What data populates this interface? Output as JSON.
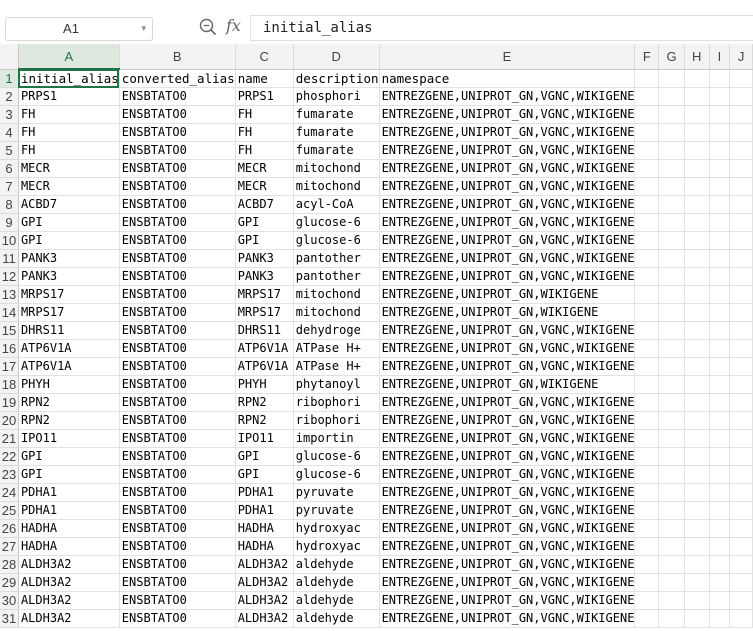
{
  "formula_bar": {
    "name_box": "A1",
    "formula": "initial_alias"
  },
  "columns": [
    "A",
    "B",
    "C",
    "D",
    "E",
    "F",
    "G",
    "H",
    "I",
    "J"
  ],
  "rows": [
    [
      "initial_alias",
      "converted_alias",
      "name",
      "description",
      "namespace"
    ],
    [
      "PRPS1",
      "ENSBTATO0",
      "PRPS1",
      "phosphori",
      "ENTREZGENE,UNIPROT_GN,VGNC,WIKIGENE"
    ],
    [
      "FH",
      "ENSBTATO0",
      "FH",
      "fumarate",
      "ENTREZGENE,UNIPROT_GN,VGNC,WIKIGENE"
    ],
    [
      "FH",
      "ENSBTATO0",
      "FH",
      "fumarate",
      "ENTREZGENE,UNIPROT_GN,VGNC,WIKIGENE"
    ],
    [
      "FH",
      "ENSBTATO0",
      "FH",
      "fumarate",
      "ENTREZGENE,UNIPROT_GN,VGNC,WIKIGENE"
    ],
    [
      "MECR",
      "ENSBTATO0",
      "MECR",
      "mitochond",
      "ENTREZGENE,UNIPROT_GN,VGNC,WIKIGENE"
    ],
    [
      "MECR",
      "ENSBTATO0",
      "MECR",
      "mitochond",
      "ENTREZGENE,UNIPROT_GN,VGNC,WIKIGENE"
    ],
    [
      "ACBD7",
      "ENSBTATO0",
      "ACBD7",
      "acyl-CoA",
      "ENTREZGENE,UNIPROT_GN,VGNC,WIKIGENE"
    ],
    [
      "GPI",
      "ENSBTATO0",
      "GPI",
      "glucose-6",
      "ENTREZGENE,UNIPROT_GN,VGNC,WIKIGENE"
    ],
    [
      "GPI",
      "ENSBTATO0",
      "GPI",
      "glucose-6",
      "ENTREZGENE,UNIPROT_GN,VGNC,WIKIGENE"
    ],
    [
      "PANK3",
      "ENSBTATO0",
      "PANK3",
      "pantother",
      "ENTREZGENE,UNIPROT_GN,VGNC,WIKIGENE"
    ],
    [
      "PANK3",
      "ENSBTATO0",
      "PANK3",
      "pantother",
      "ENTREZGENE,UNIPROT_GN,VGNC,WIKIGENE"
    ],
    [
      "MRPS17",
      "ENSBTATO0",
      "MRPS17",
      "mitochond",
      "ENTREZGENE,UNIPROT_GN,WIKIGENE"
    ],
    [
      "MRPS17",
      "ENSBTATO0",
      "MRPS17",
      "mitochond",
      "ENTREZGENE,UNIPROT_GN,WIKIGENE"
    ],
    [
      "DHRS11",
      "ENSBTATO0",
      "DHRS11",
      "dehydroge",
      "ENTREZGENE,UNIPROT_GN,VGNC,WIKIGENE"
    ],
    [
      "ATP6V1A",
      "ENSBTATO0",
      "ATP6V1A",
      "ATPase H+",
      "ENTREZGENE,UNIPROT_GN,VGNC,WIKIGENE"
    ],
    [
      "ATP6V1A",
      "ENSBTATO0",
      "ATP6V1A",
      "ATPase H+",
      "ENTREZGENE,UNIPROT_GN,VGNC,WIKIGENE"
    ],
    [
      "PHYH",
      "ENSBTATO0",
      "PHYH",
      "phytanoyl",
      "ENTREZGENE,UNIPROT_GN,WIKIGENE"
    ],
    [
      "RPN2",
      "ENSBTATO0",
      "RPN2",
      "ribophori",
      "ENTREZGENE,UNIPROT_GN,VGNC,WIKIGENE"
    ],
    [
      "RPN2",
      "ENSBTATO0",
      "RPN2",
      "ribophori",
      "ENTREZGENE,UNIPROT_GN,VGNC,WIKIGENE"
    ],
    [
      "IPO11",
      "ENSBTATO0",
      "IPO11",
      "importin",
      "ENTREZGENE,UNIPROT_GN,VGNC,WIKIGENE"
    ],
    [
      "GPI",
      "ENSBTATO0",
      "GPI",
      "glucose-6",
      "ENTREZGENE,UNIPROT_GN,VGNC,WIKIGENE"
    ],
    [
      "GPI",
      "ENSBTATO0",
      "GPI",
      "glucose-6",
      "ENTREZGENE,UNIPROT_GN,VGNC,WIKIGENE"
    ],
    [
      "PDHA1",
      "ENSBTATO0",
      "PDHA1",
      "pyruvate",
      "ENTREZGENE,UNIPROT_GN,VGNC,WIKIGENE"
    ],
    [
      "PDHA1",
      "ENSBTATO0",
      "PDHA1",
      "pyruvate",
      "ENTREZGENE,UNIPROT_GN,VGNC,WIKIGENE"
    ],
    [
      "HADHA",
      "ENSBTATO0",
      "HADHA",
      "hydroxyac",
      "ENTREZGENE,UNIPROT_GN,VGNC,WIKIGENE"
    ],
    [
      "HADHA",
      "ENSBTATO0",
      "HADHA",
      "hydroxyac",
      "ENTREZGENE,UNIPROT_GN,VGNC,WIKIGENE"
    ],
    [
      "ALDH3A2",
      "ENSBTATO0",
      "ALDH3A2",
      "aldehyde",
      "ENTREZGENE,UNIPROT_GN,VGNC,WIKIGENE"
    ],
    [
      "ALDH3A2",
      "ENSBTATO0",
      "ALDH3A2",
      "aldehyde",
      "ENTREZGENE,UNIPROT_GN,VGNC,WIKIGENE"
    ],
    [
      "ALDH3A2",
      "ENSBTATO0",
      "ALDH3A2",
      "aldehyde",
      "ENTREZGENE,UNIPROT_GN,VGNC,WIKIGENE"
    ],
    [
      "ALDH3A2",
      "ENSBTATO0",
      "ALDH3A2",
      "aldehyde",
      "ENTREZGENE,UNIPROT_GN,VGNC,WIKIGENE"
    ]
  ],
  "selection": {
    "active_cell": "A1"
  },
  "colors": {
    "accent": "#217346",
    "header_bg": "#f3f3f3",
    "grid": "#e2e2e2"
  }
}
